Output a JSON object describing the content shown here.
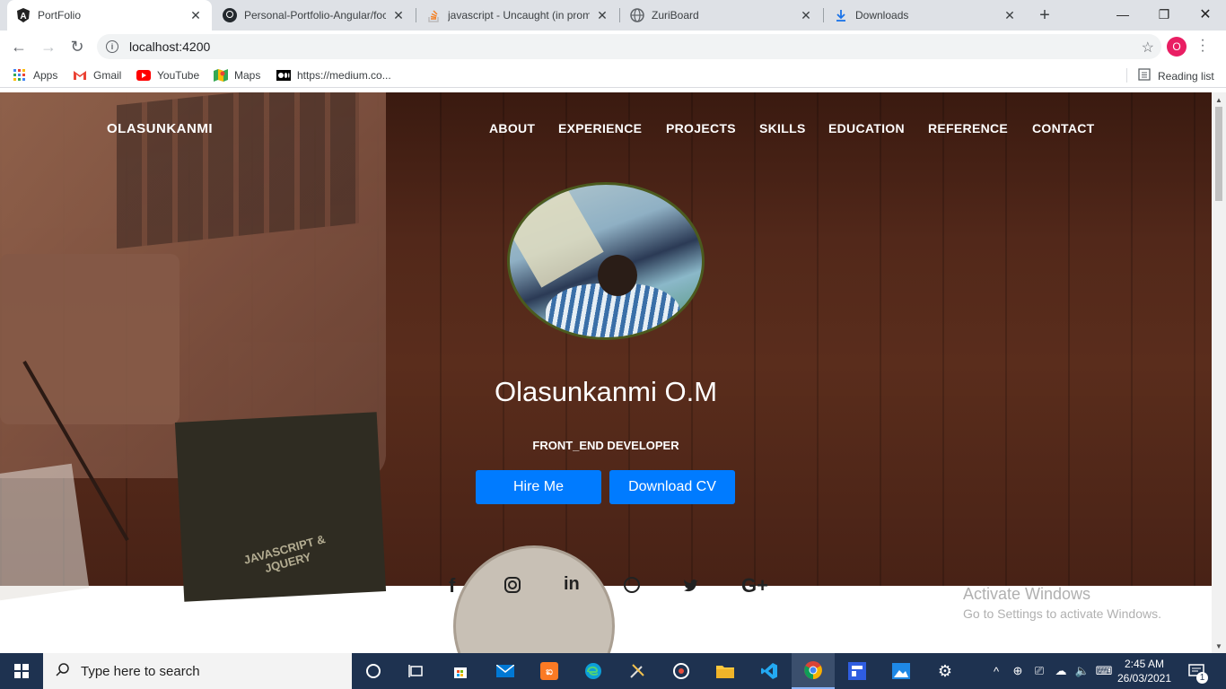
{
  "browser": {
    "tabs": [
      {
        "title": "PortFolio",
        "icon": "angular-icon",
        "active": true
      },
      {
        "title": "Personal-Portfolio-Angular/foc",
        "icon": "github-icon",
        "active": false
      },
      {
        "title": "javascript - Uncaught (in prom",
        "icon": "stackoverflow-icon",
        "active": false
      },
      {
        "title": "ZuriBoard",
        "icon": "globe-icon",
        "active": false
      },
      {
        "title": "Downloads",
        "icon": "download-icon",
        "active": false
      }
    ],
    "url": "localhost:4200",
    "profile_initial": "O",
    "profile_color": "#e91e63",
    "bookmarks": [
      {
        "label": "Apps",
        "icon": "apps-grid-icon"
      },
      {
        "label": "Gmail",
        "icon": "gmail-icon"
      },
      {
        "label": "YouTube",
        "icon": "youtube-icon"
      },
      {
        "label": "Maps",
        "icon": "maps-icon"
      },
      {
        "label": "https://medium.co...",
        "icon": "medium-icon"
      }
    ],
    "reading_list": "Reading list"
  },
  "page": {
    "brand": "OLASUNKANMI",
    "nav": [
      "ABOUT",
      "EXPERIENCE",
      "PROJECTS",
      "SKILLS",
      "EDUCATION",
      "REFERENCE",
      "CONTACT"
    ],
    "name": "Olasunkanmi O.M",
    "role": "FRONT_END DEVELOPER",
    "buttons": {
      "hire": "Hire Me",
      "cv": "Download CV"
    },
    "accent_color": "#007bff",
    "book_title": "JAVASCRIPT & JQUERY",
    "socials": [
      "facebook-icon",
      "instagram-icon",
      "linkedin-icon",
      "github-icon",
      "twitter-icon",
      "google-plus-icon"
    ]
  },
  "watermark": {
    "line1": "Activate Windows",
    "line2": "Go to Settings to activate Windows."
  },
  "taskbar": {
    "search_placeholder": "Type here to search",
    "time": "2:45 AM",
    "date": "26/03/2021",
    "notification_count": "1"
  }
}
